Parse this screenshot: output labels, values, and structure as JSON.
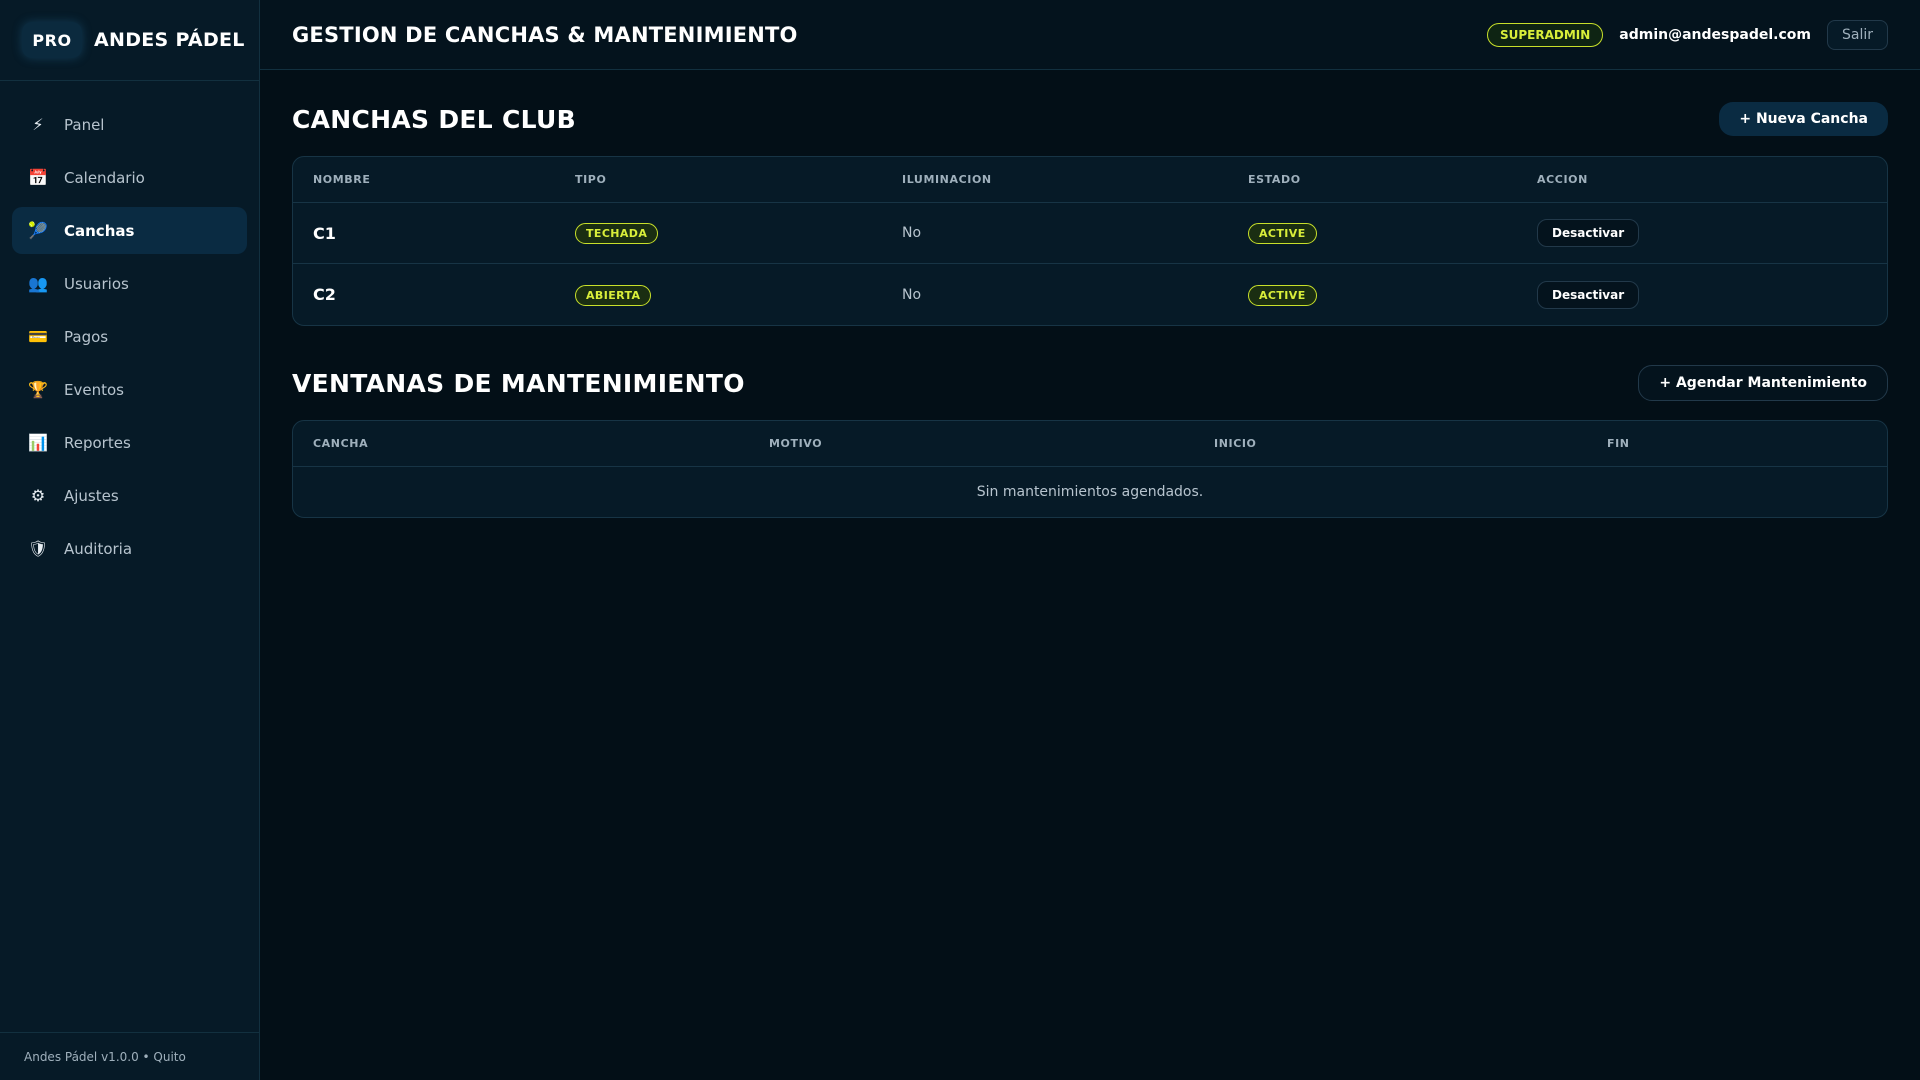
{
  "brand": {
    "logo": "PRO",
    "name": "ANDES PÁDEL"
  },
  "sidebar": {
    "items": [
      {
        "label": "Panel",
        "icon": "lightning-icon",
        "glyph": "⚡",
        "active": false
      },
      {
        "label": "Calendario",
        "icon": "calendar-icon",
        "glyph": "📅",
        "active": false
      },
      {
        "label": "Canchas",
        "icon": "tennis-ball-icon",
        "glyph": "🎾",
        "active": true
      },
      {
        "label": "Usuarios",
        "icon": "users-icon",
        "glyph": "👥",
        "active": false
      },
      {
        "label": "Pagos",
        "icon": "credit-card-icon",
        "glyph": "💳",
        "active": false
      },
      {
        "label": "Eventos",
        "icon": "trophy-icon",
        "glyph": "🏆",
        "active": false
      },
      {
        "label": "Reportes",
        "icon": "bar-chart-icon",
        "glyph": "📊",
        "active": false
      },
      {
        "label": "Ajustes",
        "icon": "gear-icon",
        "glyph": "⚙",
        "active": false
      },
      {
        "label": "Auditoria",
        "icon": "shield-icon",
        "glyph": "🛡",
        "active": false
      }
    ],
    "footer": "Andes Pádel v1.0.0 • Quito"
  },
  "header": {
    "title": "GESTION DE CANCHAS & MANTENIMIENTO",
    "role": "SUPERADMIN",
    "email": "admin@andespadel.com",
    "logout": "Salir"
  },
  "courts": {
    "title": "CANCHAS DEL CLUB",
    "new_button": "+ Nueva Cancha",
    "columns": [
      "NOMBRE",
      "TIPO",
      "ILUMINACION",
      "ESTADO",
      "ACCION"
    ],
    "rows": [
      {
        "name": "C1",
        "type": "TECHADA",
        "lighting": "No",
        "status": "ACTIVE",
        "action": "Desactivar"
      },
      {
        "name": "C2",
        "type": "ABIERTA",
        "lighting": "No",
        "status": "ACTIVE",
        "action": "Desactivar"
      }
    ]
  },
  "maintenance": {
    "title": "VENTANAS DE MANTENIMIENTO",
    "schedule_button": "+ Agendar Mantenimiento",
    "columns": [
      "CANCHA",
      "MOTIVO",
      "INICIO",
      "FIN"
    ],
    "empty": "Sin mantenimientos agendados."
  },
  "colors": {
    "accent": "#c8e02a",
    "background": "#030f17",
    "sidebar": "#061a27",
    "active_item": "#0a2b42"
  }
}
